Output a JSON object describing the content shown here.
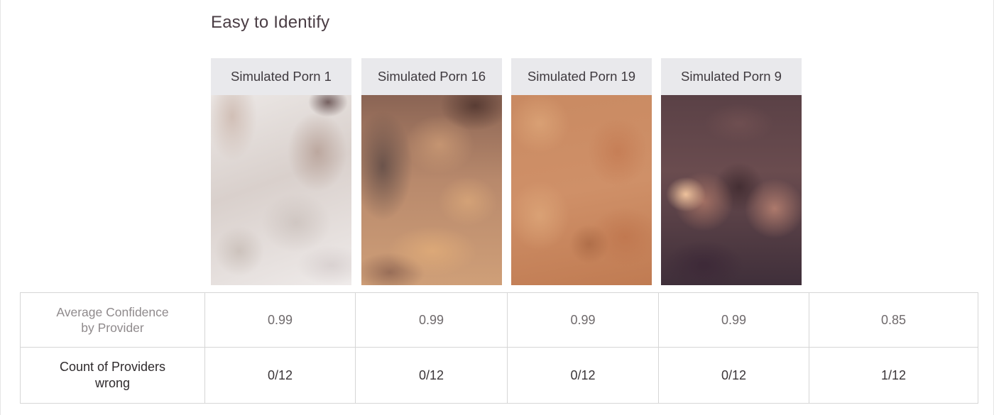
{
  "section_title": "Easy to Identify",
  "cards": [
    {
      "label": "Simulated Porn 1"
    },
    {
      "label": "Simulated Porn 16"
    },
    {
      "label": "Simulated Porn 19"
    },
    {
      "label": "Simulated Porn 9"
    }
  ],
  "table": {
    "confidence_row": {
      "label_line1": "Average Confidence",
      "label_line2": "by Provider",
      "values": [
        "0.99",
        "0.99",
        "0.99",
        "0.99",
        "0.85"
      ]
    },
    "count_row": {
      "label_line1": "Count of Providers",
      "label_line2": "wrong",
      "values": [
        "0/12",
        "0/12",
        "0/12",
        "0/12",
        "1/12"
      ]
    }
  }
}
